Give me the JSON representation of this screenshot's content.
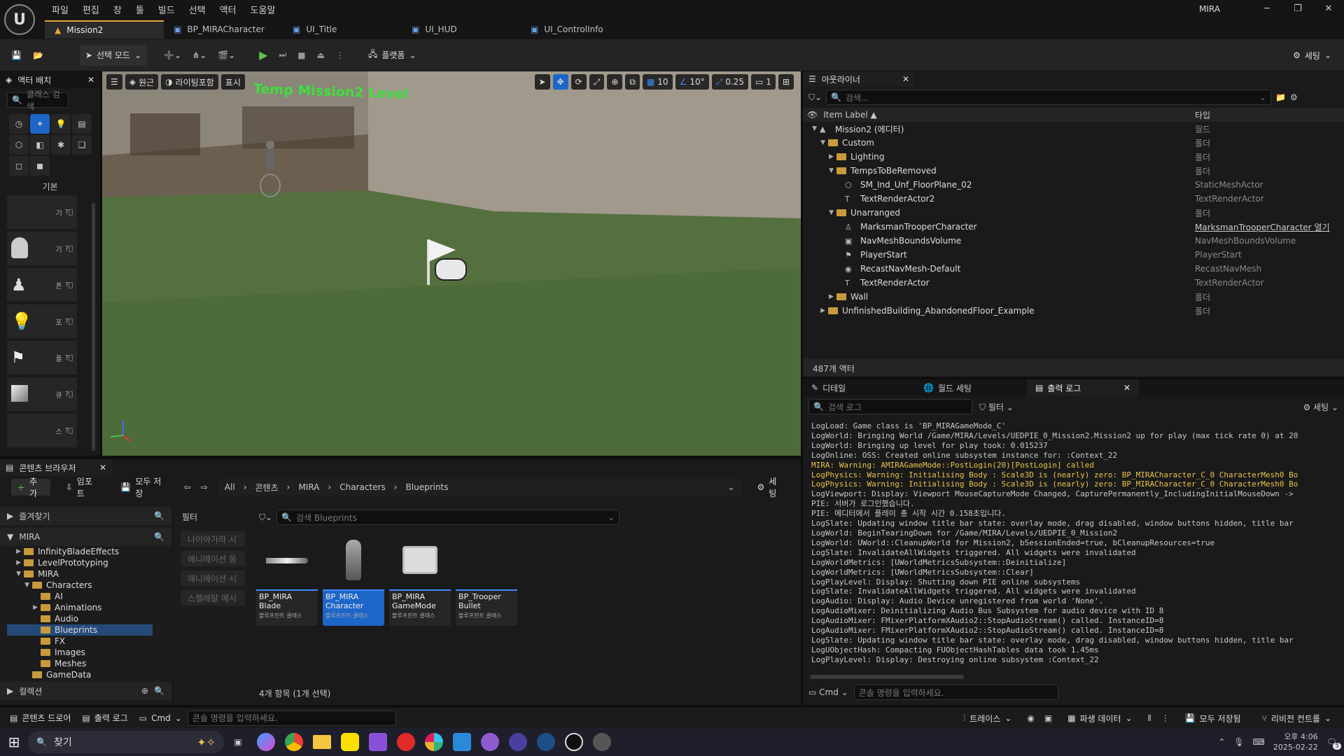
{
  "app": {
    "project_name": "MIRA",
    "menu": [
      "파일",
      "편집",
      "창",
      "툴",
      "빌드",
      "선택",
      "액터",
      "도움말"
    ],
    "tabs": [
      {
        "label": "Mission2",
        "active": true
      },
      {
        "label": "BP_MIRACharacter",
        "active": false
      },
      {
        "label": "UI_Title",
        "active": false
      },
      {
        "label": "UI_HUD",
        "active": false
      },
      {
        "label": "UI_ControlInfo",
        "active": false
      }
    ]
  },
  "toolbar": {
    "select_mode": "선택 모드",
    "platform": "플랫폼",
    "settings": "세팅"
  },
  "place_actors": {
    "title": "액터 배치",
    "search_placeholder": "클래스 검색",
    "category": "기본",
    "items": [
      {
        "icon": "sphere-icon",
        "label": "기"
      },
      {
        "icon": "character-icon",
        "label": "기"
      },
      {
        "icon": "pawn-icon",
        "label": "폰"
      },
      {
        "icon": "light-icon",
        "label": "포"
      },
      {
        "icon": "player-start-icon",
        "label": "플"
      },
      {
        "icon": "cube-icon",
        "label": "큐"
      },
      {
        "icon": "sphere-icon",
        "label": "스"
      }
    ]
  },
  "viewport": {
    "perspective": "원근",
    "lighting": "라이팅포함",
    "show": "표시",
    "level_text": "Temp Mission2 Level",
    "grid_snap": "10",
    "rotation_snap": "10°",
    "scale_snap": "0.25",
    "camera_speed": "1"
  },
  "outliner": {
    "title": "아웃라이너",
    "search_placeholder": "검색...",
    "col_label": "Item Label ▲",
    "col_type": "타입",
    "count": "487개 액터",
    "rows": [
      {
        "indent": 0,
        "kind": "world",
        "expand": "▼",
        "label": "Mission2 (에디터)",
        "type": "월드"
      },
      {
        "indent": 1,
        "kind": "folder",
        "expand": "▼",
        "label": "Custom",
        "type": "폴더"
      },
      {
        "indent": 2,
        "kind": "folder",
        "expand": "▶",
        "label": "Lighting",
        "type": "폴더"
      },
      {
        "indent": 2,
        "kind": "folder",
        "expand": "▼",
        "label": "TempsToBeRemoved",
        "type": "폴더"
      },
      {
        "indent": 3,
        "kind": "mesh",
        "expand": "",
        "label": "SM_Ind_Unf_FloorPlane_02",
        "type": "StaticMeshActor"
      },
      {
        "indent": 3,
        "kind": "text",
        "expand": "",
        "label": "TextRenderActor2",
        "type": "TextRenderActor"
      },
      {
        "indent": 2,
        "kind": "folder",
        "expand": "▼",
        "label": "Unarranged",
        "type": "폴더"
      },
      {
        "indent": 3,
        "kind": "char",
        "expand": "",
        "label": "MarksmanTrooperCharacter",
        "type": "MarksmanTrooperCharacter 열기"
      },
      {
        "indent": 3,
        "kind": "volume",
        "expand": "",
        "label": "NavMeshBoundsVolume",
        "type": "NavMeshBoundsVolume"
      },
      {
        "indent": 3,
        "kind": "start",
        "expand": "",
        "label": "PlayerStart",
        "type": "PlayerStart"
      },
      {
        "indent": 3,
        "kind": "nav",
        "expand": "",
        "label": "RecastNavMesh-Default",
        "type": "RecastNavMesh"
      },
      {
        "indent": 3,
        "kind": "text",
        "expand": "",
        "label": "TextRenderActor",
        "type": "TextRenderActor"
      },
      {
        "indent": 2,
        "kind": "folder",
        "expand": "▶",
        "label": "Wall",
        "type": "폴더"
      },
      {
        "indent": 1,
        "kind": "folder",
        "expand": "▶",
        "label": "UnfinishedBuilding_AbandonedFloor_Example",
        "type": "폴더"
      }
    ]
  },
  "lower_tabs": {
    "details": "디테일",
    "world_settings": "월드 세팅",
    "output_log": "출력 로그",
    "search_placeholder": "검색 로그",
    "filter": "필터",
    "settings": "세팅",
    "cmd": "Cmd",
    "cmd_placeholder": "콘솔 명령을 입력하세요."
  },
  "log_lines": [
    {
      "t": "LogLoad: Game class is 'BP_MIRAGameMode_C'",
      "w": false
    },
    {
      "t": "LogWorld: Bringing World /Game/MIRA/Levels/UEDPIE_0_Mission2.Mission2 up for play (max tick rate 0) at 20",
      "w": false
    },
    {
      "t": "LogWorld: Bringing up level for play took: 0.015237",
      "w": false
    },
    {
      "t": "LogOnline: OSS: Created online subsystem instance for: :Context_22",
      "w": false
    },
    {
      "t": "MIRA: Warning: AMIRAGameMode::PostLogin(20)[PostLogin] called",
      "w": true
    },
    {
      "t": "LogPhysics: Warning: Initialising Body : Scale3D is (nearly) zero: BP_MIRACharacter_C_0 CharacterMesh0 Bo",
      "w": true
    },
    {
      "t": "LogPhysics: Warning: Initialising Body : Scale3D is (nearly) zero: BP_MIRACharacter_C_0 CharacterMesh0 Bo",
      "w": true
    },
    {
      "t": "LogViewport: Display: Viewport MouseCaptureMode Changed, CapturePermanently_IncludingInitialMouseDown ->",
      "w": false
    },
    {
      "t": "PIE: 서버가 로그인했습니다.",
      "w": false
    },
    {
      "t": "PIE: 에디터에서 플레이 총 시작 시간 0.158초입니다.",
      "w": false
    },
    {
      "t": "LogSlate: Updating window title bar state: overlay mode, drag disabled, window buttons hidden, title bar",
      "w": false
    },
    {
      "t": "LogWorld: BeginTearingDown for /Game/MIRA/Levels/UEDPIE_0_Mission2",
      "w": false
    },
    {
      "t": "LogWorld: UWorld::CleanupWorld for Mission2, bSessionEnded=true, bCleanupResources=true",
      "w": false
    },
    {
      "t": "LogSlate: InvalidateAllWidgets triggered.  All widgets were invalidated",
      "w": false
    },
    {
      "t": "LogWorldMetrics: [UWorldMetricsSubsystem::Deinitialize]",
      "w": false
    },
    {
      "t": "LogWorldMetrics: [UWorldMetricsSubsystem::Clear]",
      "w": false
    },
    {
      "t": "LogPlayLevel: Display: Shutting down PIE online subsystems",
      "w": false
    },
    {
      "t": "LogSlate: InvalidateAllWidgets triggered.  All widgets were invalidated",
      "w": false
    },
    {
      "t": "LogAudio: Display: Audio Device unregistered from world 'None'.",
      "w": false
    },
    {
      "t": "LogAudioMixer: Deinitializing Audio Bus Subsystem for audio device with ID 8",
      "w": false
    },
    {
      "t": "LogAudioMixer: FMixerPlatformXAudio2::StopAudioStream() called. InstanceID=8",
      "w": false
    },
    {
      "t": "LogAudioMixer: FMixerPlatformXAudio2::StopAudioStream() called. InstanceID=8",
      "w": false
    },
    {
      "t": "LogSlate: Updating window title bar state: overlay mode, drag disabled, window buttons hidden, title bar",
      "w": false
    },
    {
      "t": "LogUObjectHash: Compacting FUObjectHashTables data took   1.45ms",
      "w": false
    },
    {
      "t": "LogPlayLevel: Display: Destroying online subsystem :Context_22",
      "w": false
    }
  ],
  "content_browser": {
    "title": "콘텐츠 브라우저",
    "add": "추가",
    "import": "임포트",
    "save_all": "모두 저장",
    "settings": "세팅",
    "path": [
      "All",
      "콘텐츠",
      "MIRA",
      "Characters",
      "Blueprints"
    ],
    "favorites": "즐겨찾기",
    "root": "MIRA",
    "collections": "컬렉션",
    "filter_title": "필터",
    "filters": [
      "나이아가라 시",
      "애니메이션 몽",
      "애니메이션 시",
      "스켈레탈 메시"
    ],
    "search_placeholder": "검색 Blueprints",
    "tree": [
      {
        "indent": 2,
        "label": "InfinityBladeEffects",
        "exp": "▶",
        "sel": false
      },
      {
        "indent": 2,
        "label": "LevelPrototyping",
        "exp": "▶",
        "sel": false
      },
      {
        "indent": 2,
        "label": "MIRA",
        "exp": "▼",
        "sel": false
      },
      {
        "indent": 3,
        "label": "Characters",
        "exp": "▼",
        "sel": false
      },
      {
        "indent": 4,
        "label": "AI",
        "exp": "",
        "sel": false
      },
      {
        "indent": 4,
        "label": "Animations",
        "exp": "▶",
        "sel": false
      },
      {
        "indent": 4,
        "label": "Audio",
        "exp": "",
        "sel": false
      },
      {
        "indent": 4,
        "label": "Blueprints",
        "exp": "",
        "sel": true
      },
      {
        "indent": 4,
        "label": "FX",
        "exp": "",
        "sel": false
      },
      {
        "indent": 4,
        "label": "Images",
        "exp": "",
        "sel": false
      },
      {
        "indent": 4,
        "label": "Meshes",
        "exp": "",
        "sel": false
      },
      {
        "indent": 3,
        "label": "GameData",
        "exp": "",
        "sel": false
      }
    ],
    "assets": [
      {
        "name": "BP_MIRA Blade",
        "sub": "블루프린트 클래스",
        "icon": "blade-icon",
        "sel": false
      },
      {
        "name": "BP_MIRA Character",
        "sub": "블루프린트 클래스",
        "icon": "character-icon",
        "sel": true
      },
      {
        "name": "BP_MIRA GameMode",
        "sub": "블루프린트 클래스",
        "icon": "gamemode-icon",
        "sel": false
      },
      {
        "name": "BP_Trooper Bullet",
        "sub": "블루프린트 클래스",
        "icon": "sphere-icon",
        "sel": false
      }
    ],
    "count": "4개 항목 (1개 선택)"
  },
  "statusbar": {
    "content_drawer": "콘텐츠 드로어",
    "output_log": "출력 로그",
    "cmd": "Cmd",
    "cmd_placeholder": "콘솔 명령을 입력하세요.",
    "trace": "트레이스",
    "derived_data": "파생 데이터",
    "save_all": "모두 저장됨",
    "revision": "리비전 컨트롤"
  },
  "taskbar": {
    "search": "찾기",
    "time": "오후 4:06",
    "date": "2025-02-22",
    "notif_count": "5"
  }
}
